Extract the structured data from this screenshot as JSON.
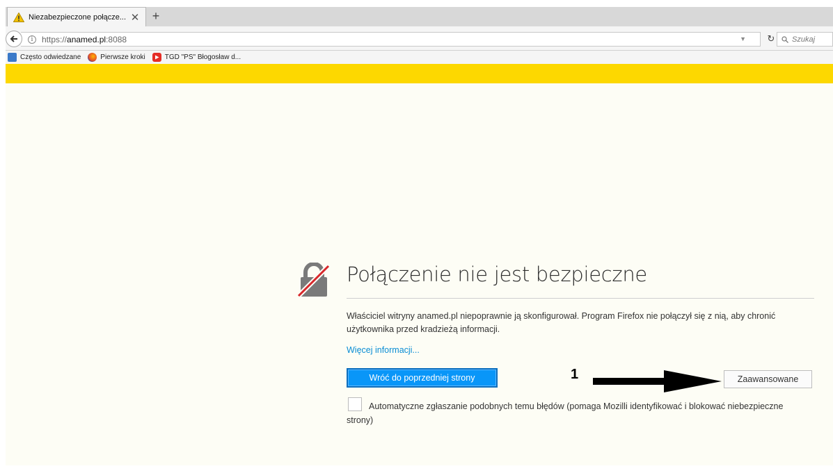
{
  "tab": {
    "title": "Niezabezpieczone połącze...",
    "close": "✕",
    "new": "+"
  },
  "nav": {
    "url_prefix": "https://",
    "url_host": "anamed.pl",
    "url_port": ":8088",
    "reload": "↻",
    "search_placeholder": "Szukaj"
  },
  "bookmarks": [
    {
      "label": "Często odwiedzane",
      "icon": "frequent-icon"
    },
    {
      "label": "Pierwsze kroki",
      "icon": "firefox-icon"
    },
    {
      "label": "TGD \"PS\" Błogosław d...",
      "icon": "youtube-icon"
    }
  ],
  "error": {
    "heading": "Połączenie nie jest bezpieczne",
    "description": "Właściciel witryny anamed.pl niepoprawnie ją skonfigurował. Program Firefox nie połączył się z nią, aby chronić użytkownika przed kradzieżą informacji.",
    "more_info": "Więcej informacji...",
    "back_button": "Wróć do poprzedniej strony",
    "advanced_button": "Zaawansowane",
    "checkbox_label": "Automatyczne zgłaszanie podobnych temu błędów (pomaga Mozilli identyfikować i blokować niebezpieczne strony)"
  },
  "annotation": {
    "number": "1"
  },
  "colors": {
    "accent": "#0996f8",
    "warning_bar": "#fdd800",
    "link": "#0a8dd4"
  }
}
